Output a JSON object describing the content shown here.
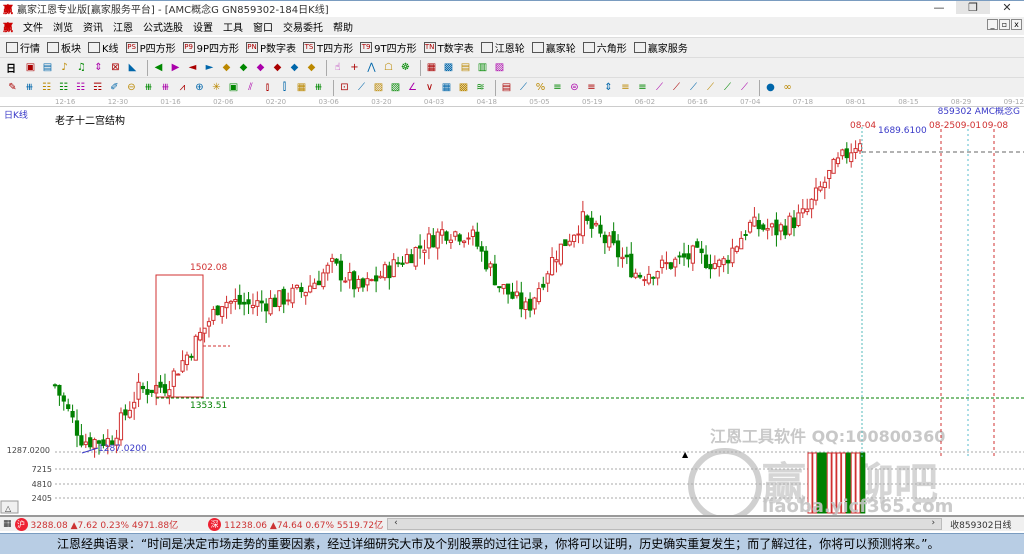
{
  "window": {
    "title": "赢家江恩专业版[赢家服务平台] - [AMC概念G  GN859302-184日K线]",
    "min": "—",
    "max": "❐",
    "close": "✕"
  },
  "menu": [
    "文件",
    "浏览",
    "资讯",
    "江恩",
    "公式选股",
    "设置",
    "工具",
    "窗口",
    "交易委托",
    "帮助"
  ],
  "toolbar1": [
    {
      "icon": "grid-icon",
      "label": "行情"
    },
    {
      "icon": "blocks-icon",
      "label": "板块"
    },
    {
      "icon": "candle-icon",
      "label": "K线"
    },
    {
      "icon": "PS",
      "label": "P四方形"
    },
    {
      "icon": "P9",
      "label": "9P四方形"
    },
    {
      "icon": "PN",
      "label": "P数字表"
    },
    {
      "icon": "TS",
      "label": "T四方形"
    },
    {
      "icon": "T9",
      "label": "9T四方形"
    },
    {
      "icon": "TN",
      "label": "T数字表"
    },
    {
      "icon": "target-icon",
      "label": "江恩轮"
    },
    {
      "icon": "wheel-icon",
      "label": "赢家轮"
    },
    {
      "icon": "hexagon-icon",
      "label": "六角形"
    },
    {
      "icon": "dollar-icon",
      "label": "赢家服务"
    }
  ],
  "period_selector": "日",
  "date_axis": [
    "12-16",
    "12-30",
    "01-16",
    "02-06",
    "02-20",
    "03-06",
    "03-20",
    "04-03",
    "04-18",
    "05-05",
    "05-19",
    "06-02",
    "06-16",
    "07-04",
    "07-18",
    "08-01",
    "08-15",
    "08-29",
    "09-12"
  ],
  "chart": {
    "period_label": "日K线",
    "study_title": "老子十二宫结构",
    "symbol_label": "859302 AMC概念G",
    "high_date": "08-04",
    "high_value": "1689.6100",
    "future_dates": [
      "08-25",
      "09-01",
      "09-08"
    ],
    "box_high": "1502.08",
    "box_low": "1353.51",
    "low_value": "1287.0200",
    "axis_low": "1287.0200",
    "volume_ticks": [
      "7215",
      "4810",
      "2405"
    ],
    "watermark1": "江恩工具软件  QQ:100800360",
    "watermark2": "赢家聊吧",
    "watermark3": "liaoba.yicf365.com",
    "colors": {
      "up": "#d03030",
      "down": "#008000",
      "annot": "#3a3ac8"
    }
  },
  "chart_data": {
    "type": "candlestick",
    "keypoints_price": [
      1368,
      1305,
      1305,
      1362,
      1368,
      1414,
      1465,
      1460,
      1465,
      1477,
      1505,
      1477,
      1500,
      1523,
      1545,
      1540,
      1483,
      1454,
      1517,
      1557,
      1528,
      1494,
      1505,
      1517,
      1505,
      1551,
      1545,
      1563,
      1614,
      1650
    ],
    "candles": 184,
    "ylim": [
      1287.02,
      1689.61
    ]
  },
  "status": {
    "sh": "3288.08 ▲7.62 0.23% 4971.88亿",
    "sz": "11238.06 ▲74.64 0.67% 5519.72亿",
    "sh_icon": "沪",
    "sz_icon": "深",
    "right": "收859302日线"
  },
  "banner": "江恩经典语录：“时间是决定市场走势的重要因素，经过详细研究大市及个别股票的过往记录，你将可以证明，历史确实重复发生；而了解过往，你将可以预测将来。”。"
}
